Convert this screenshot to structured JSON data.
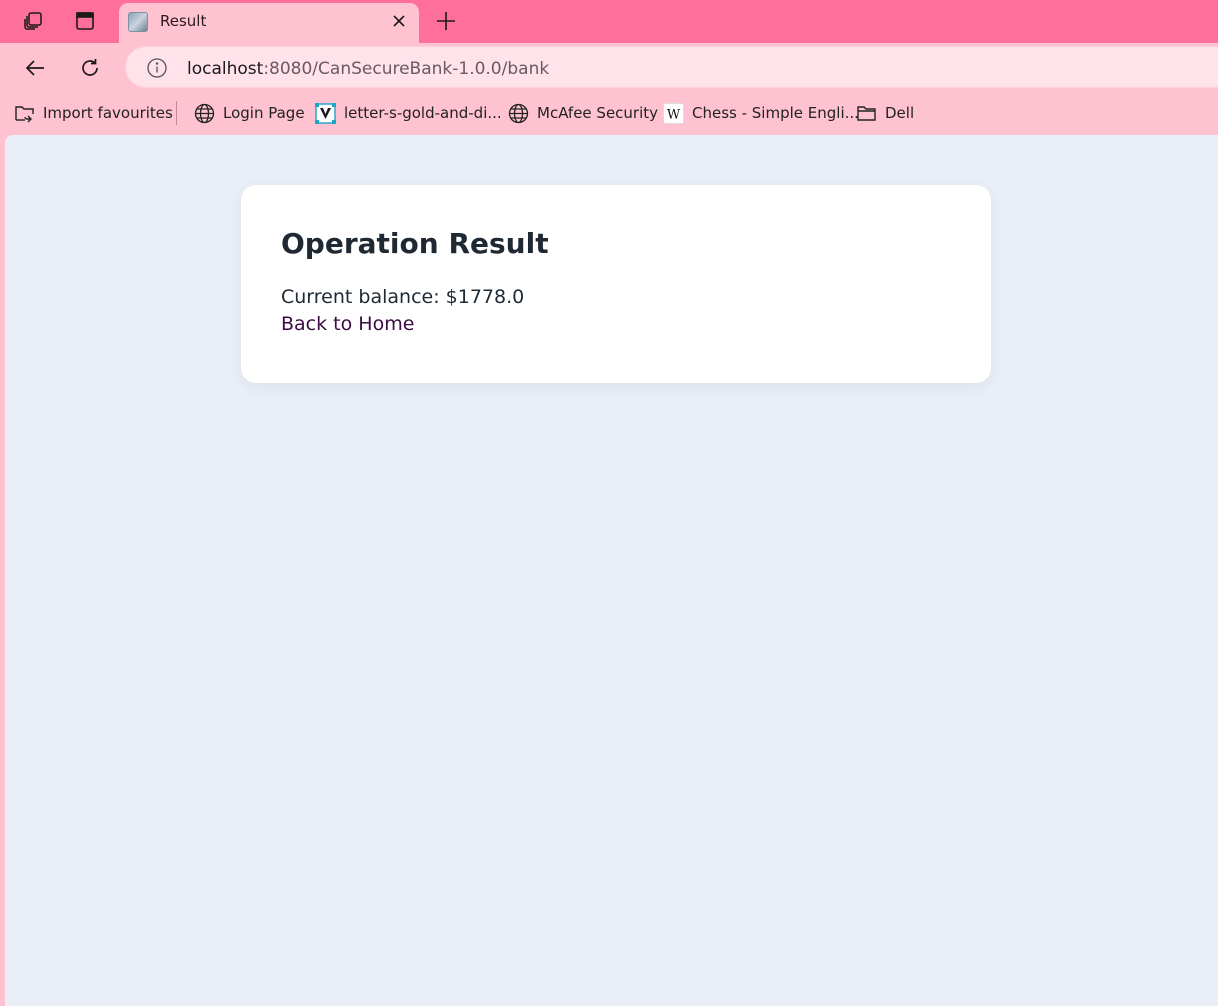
{
  "tab": {
    "title": "Result"
  },
  "address": {
    "host": "localhost",
    "rest": ":8080/CanSecureBank-1.0.0/bank"
  },
  "bookmarks": [
    {
      "label": "Import favourites",
      "icon": "import-icon"
    },
    {
      "label": "Login Page",
      "icon": "globe-icon"
    },
    {
      "label": "letter-s-gold-and-di...",
      "icon": "v-logo-icon"
    },
    {
      "label": "McAfee Security",
      "icon": "globe-icon"
    },
    {
      "label": "Chess - Simple Engli...",
      "icon": "wikipedia-icon"
    },
    {
      "label": "Dell",
      "icon": "folder-icon"
    }
  ],
  "page": {
    "heading": "Operation Result",
    "balance_text": "Current balance: $1778.0",
    "back_link": "Back to Home"
  },
  "colors": {
    "tabstrip": "#ff6f9c",
    "toolbar": "#ffc2d1",
    "content_bg": "#eaeef6",
    "link": "#3c0b44"
  }
}
